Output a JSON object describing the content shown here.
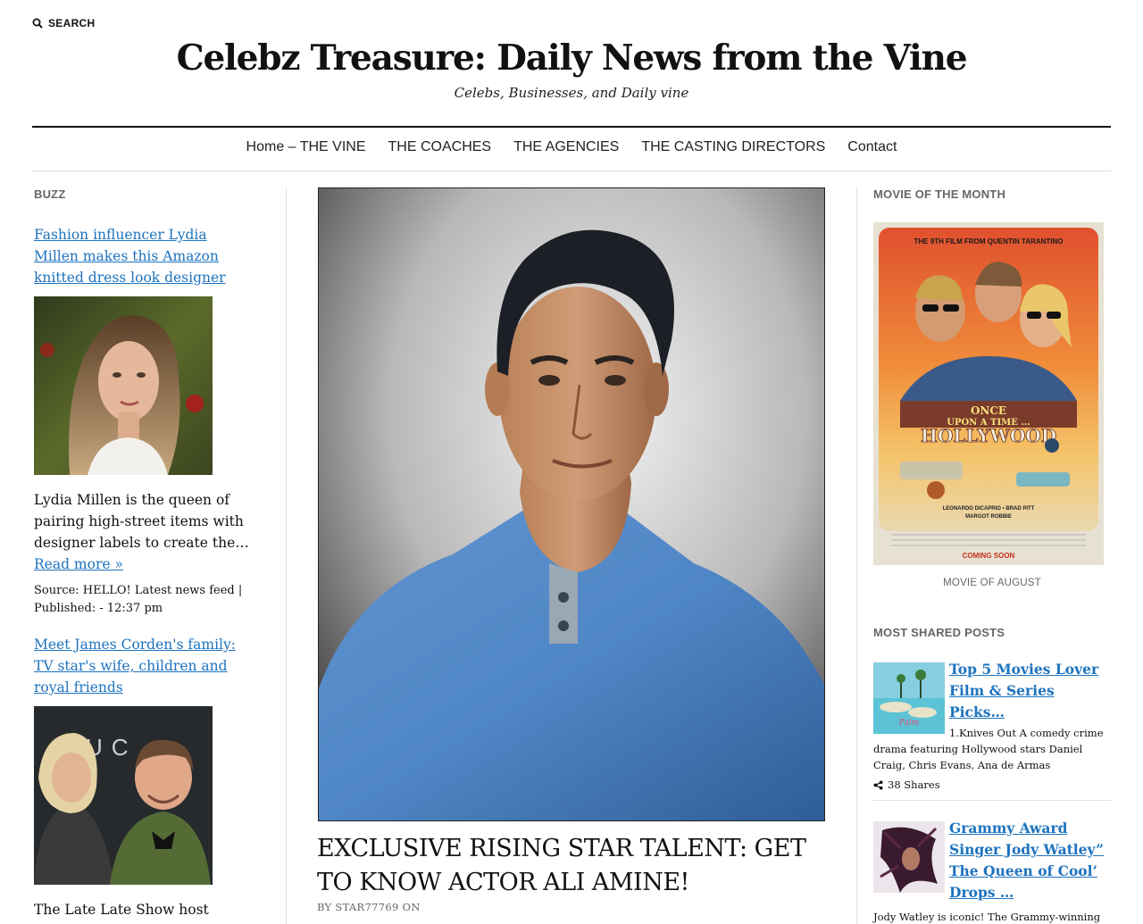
{
  "header": {
    "search_label": "SEARCH",
    "site_title": "Celebz Treasure: Daily News from the Vine",
    "tagline": "Celebs, Businesses, and Daily vine"
  },
  "nav": {
    "items": [
      {
        "label": "Home – THE VINE"
      },
      {
        "label": "THE COACHES"
      },
      {
        "label": "THE AGENCIES"
      },
      {
        "label": "THE CASTING DIRECTORS"
      },
      {
        "label": "Contact"
      }
    ]
  },
  "buzz": {
    "title": "BUZZ",
    "items": [
      {
        "headline": "Fashion influencer Lydia Millen makes this Amazon knitted dress look designer",
        "excerpt": "Lydia Millen is the queen of pairing high-street items with designer labels to create the…",
        "read_more": "Read more »",
        "source": "Source: HELLO! Latest news feed | Published: - 12:37 pm"
      },
      {
        "headline": "Meet James Corden's family: TV star's wife, children and royal friends",
        "excerpt": "The Late Late Show host James Corden is the proud father of three children"
      }
    ]
  },
  "article": {
    "title": "EXCLUSIVE RISING STAR TALENT: GET TO KNOW ACTOR ALI AMINE!",
    "byline": "BY STAR77769 ON"
  },
  "sidebar": {
    "movie_title": "MOVIE OF THE MONTH",
    "poster": {
      "top_text": "THE 9TH FILM FROM QUENTIN TARANTINO",
      "line1": "ONCE",
      "line2": "UPON A TIME ...",
      "line3": "HOLLYWOOD",
      "cast": "LEONARDO DICAPRIO • BRAD PITT",
      "cast2": "MARGOT ROBBIE",
      "coming": "COMING SOON"
    },
    "movie_caption": "MOVIE OF AUGUST",
    "shared_title": "MOST SHARED POSTS",
    "shared_posts": [
      {
        "title": "Top 5 Movies Lover Film & Series Picks…",
        "excerpt": "1.Knives Out A comedy crime drama featuring Hollywood stars Daniel Craig, Chris Evans, Ana de Armas",
        "shares": "38 Shares"
      },
      {
        "title": "Grammy Award Singer Jody Watley” The Queen of Cool’ Drops …",
        "excerpt": "Jody Watley is iconic! The Grammy-winning trendsetting ageless beauty in music, video,"
      }
    ]
  },
  "colors": {
    "link": "#1e73be",
    "widget_title": "#666666",
    "rule": "#111111"
  }
}
